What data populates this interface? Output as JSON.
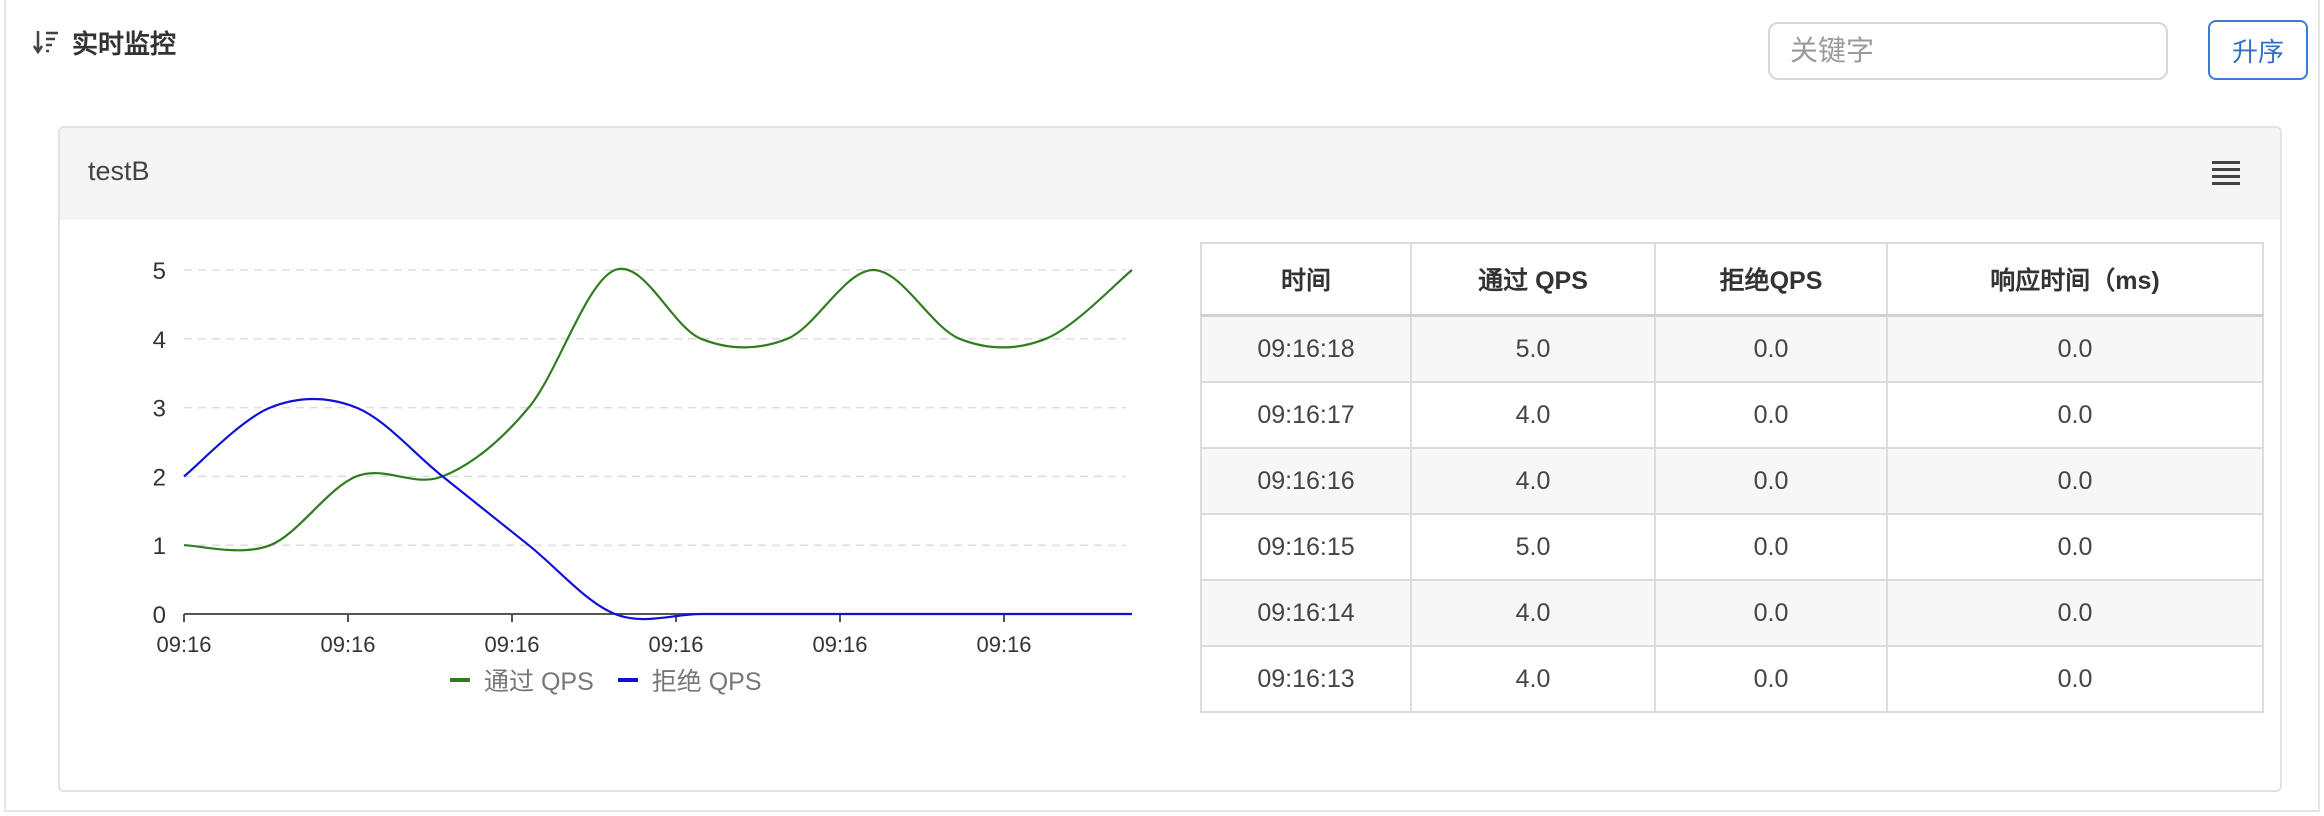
{
  "header": {
    "title": "实时监控",
    "search_placeholder": "关键字",
    "sort_button": "升序"
  },
  "panel": {
    "title": "testB"
  },
  "colors": {
    "pass": "#2e7d1e",
    "block": "#1010d8",
    "accent": "#2f6fc8"
  },
  "chart_data": {
    "type": "line",
    "x": [
      "09:16",
      "09:16",
      "09:16",
      "09:16",
      "09:16",
      "09:16"
    ],
    "ylim": [
      0,
      5
    ],
    "yticks": [
      0,
      1,
      2,
      3,
      4,
      5
    ],
    "grid": true,
    "legend_position": "bottom",
    "series": [
      {
        "name": "通过 QPS",
        "values": [
          1,
          1,
          2,
          2,
          3,
          5,
          4,
          4,
          5,
          4,
          4,
          5
        ]
      },
      {
        "name": "拒绝 QPS",
        "values": [
          2,
          3,
          3,
          2,
          1,
          0,
          0,
          0,
          0,
          0,
          0,
          0
        ]
      }
    ]
  },
  "table": {
    "headers": [
      "时间",
      "通过 QPS",
      "拒绝QPS",
      "响应时间（ms)"
    ],
    "rows": [
      [
        "09:16:18",
        "5.0",
        "0.0",
        "0.0"
      ],
      [
        "09:16:17",
        "4.0",
        "0.0",
        "0.0"
      ],
      [
        "09:16:16",
        "4.0",
        "0.0",
        "0.0"
      ],
      [
        "09:16:15",
        "5.0",
        "0.0",
        "0.0"
      ],
      [
        "09:16:14",
        "4.0",
        "0.0",
        "0.0"
      ],
      [
        "09:16:13",
        "4.0",
        "0.0",
        "0.0"
      ]
    ]
  }
}
